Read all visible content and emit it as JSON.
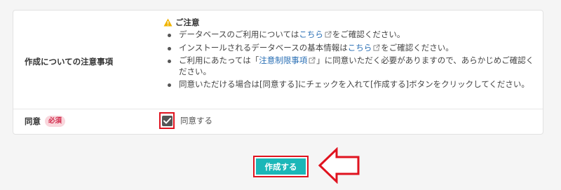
{
  "form": {
    "notes_label": "作成についての注意事項",
    "agree_label": "同意",
    "required_badge": "必須",
    "notice": {
      "title": "ご注意",
      "items": [
        {
          "before": "データベースのご利用については",
          "link": "こちら",
          "after": "をご確認ください。"
        },
        {
          "before": "インストールされるデータベースの基本情報は",
          "link": "こちら",
          "after": "をご確認ください。"
        },
        {
          "before": "ご利用にあたっては「",
          "link": "注意制限事項",
          "after": "」に同意いただく必要がありますので、あらかじめご確認ください。"
        },
        {
          "text": "同意いただける場合は[同意する]にチェックを入れて[作成する]ボタンをクリックしてください。"
        }
      ]
    },
    "agree_checkbox_label": "同意する",
    "agree_checked": true,
    "create_button": "作成する"
  },
  "colors": {
    "accent": "#1bb7b8",
    "highlight_red": "#e0131f",
    "link": "#2a6fb5",
    "warning": "#f0b400",
    "badge_bg": "#f9d7dd",
    "badge_text": "#d1294a"
  },
  "icons": {
    "warning": "warning-triangle-icon",
    "external_link": "external-link-icon",
    "checkmark": "checkmark-icon",
    "arrow": "left-arrow-icon"
  }
}
